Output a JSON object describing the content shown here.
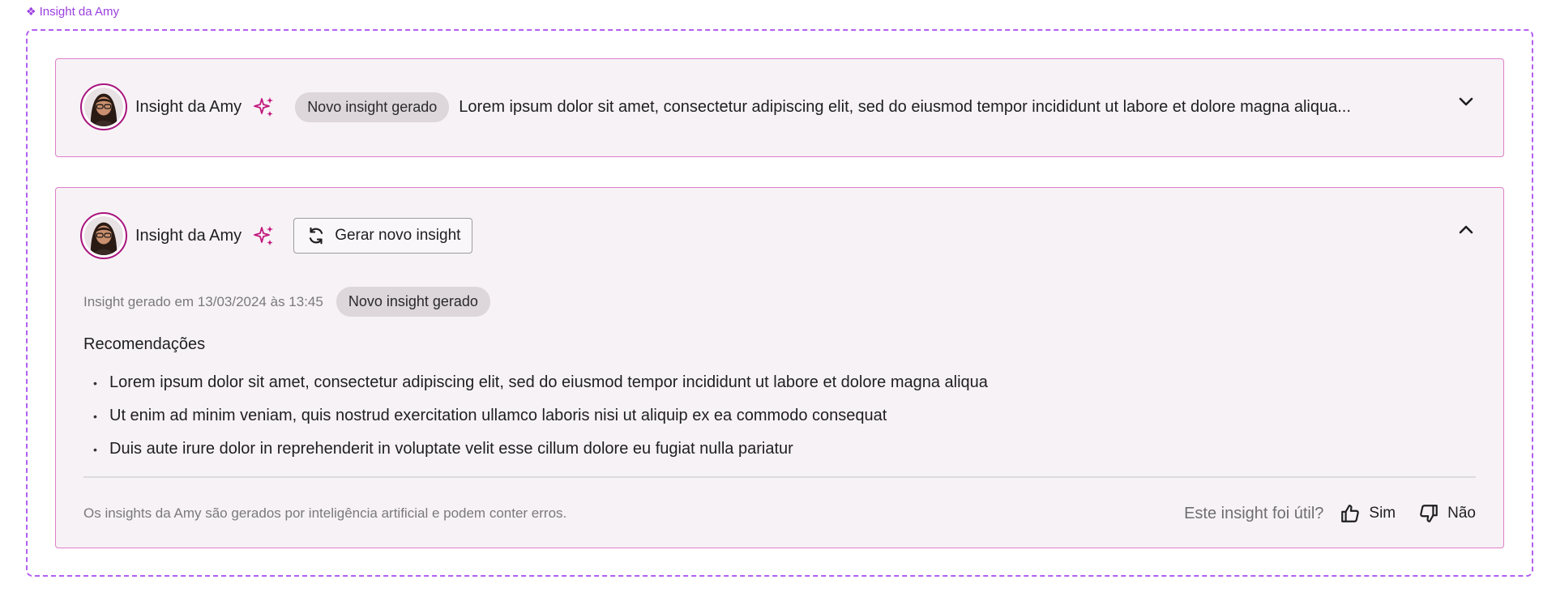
{
  "component_label": "Insight da Amy",
  "colors": {
    "accent_purple": "#9b3fe0",
    "card_border": "#e07fc9",
    "card_bg": "#f7f2f6",
    "avatar_ring": "#a8147d",
    "sparkle": "#c2187e",
    "chip_bg": "#ddd7dc"
  },
  "collapsed_card": {
    "title": "Insight da Amy",
    "chip": "Novo insight gerado",
    "preview": "Lorem ipsum dolor sit amet, consectetur adipiscing elit, sed do eiusmod tempor incididunt ut labore et dolore magna aliqua...",
    "toggle_icon": "chevron-down-icon"
  },
  "expanded_card": {
    "title": "Insight da Amy",
    "regenerate_label": "Gerar novo insight",
    "toggle_icon": "chevron-up-icon",
    "generated_at": "Insight gerado em 13/03/2024 às 13:45",
    "chip": "Novo insight gerado",
    "recommendations_title": "Recomendações",
    "recommendations": [
      "Lorem ipsum dolor sit amet, consectetur adipiscing elit, sed do eiusmod tempor incididunt ut labore et dolore magna aliqua",
      "Ut enim ad minim veniam, quis nostrud exercitation ullamco laboris nisi ut aliquip ex ea commodo consequat",
      "Duis aute irure dolor in reprehenderit in voluptate velit esse cillum dolore eu fugiat nulla pariatur"
    ],
    "disclaimer": "Os insights da Amy são gerados por inteligência artificial e podem conter erros.",
    "feedback_question": "Este insight foi útil?",
    "yes_label": "Sim",
    "no_label": "Não"
  }
}
